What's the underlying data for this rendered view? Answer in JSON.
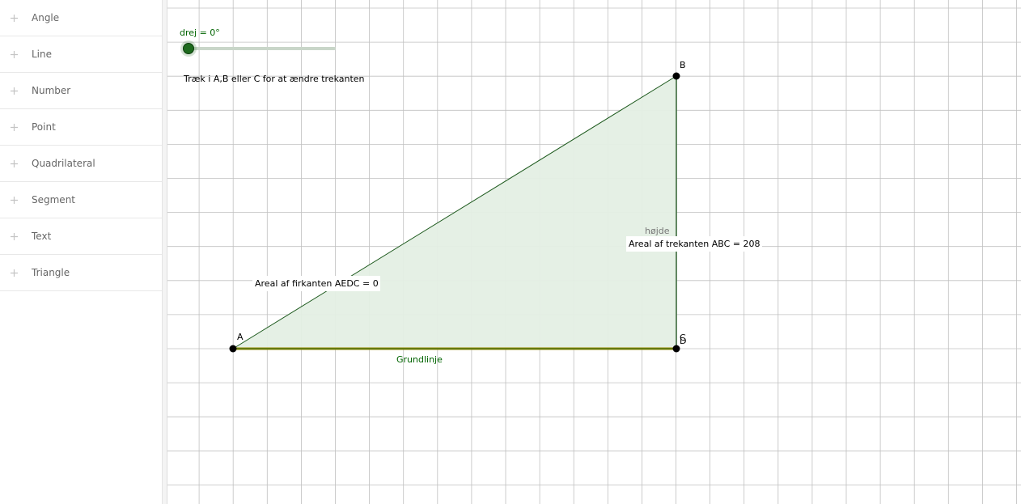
{
  "sidebar": {
    "items": [
      {
        "label": "Angle"
      },
      {
        "label": "Line"
      },
      {
        "label": "Number"
      },
      {
        "label": "Point"
      },
      {
        "label": "Quadrilateral"
      },
      {
        "label": "Segment"
      },
      {
        "label": "Text"
      },
      {
        "label": "Triangle"
      }
    ]
  },
  "graphics": {
    "slider": {
      "label": "drej = 0°",
      "value_degrees": 0
    },
    "instruction": "Træk i A,B eller C for at ændre trekanten",
    "points": {
      "A": "A",
      "B": "B",
      "C": "C",
      "D": "D"
    },
    "labels": {
      "baseline": "Grundlinje",
      "height": "højde",
      "area_triangle": "Areal af trekanten ABC = 208",
      "area_quadrilateral": "Areal af firkanten AEDC = 0"
    },
    "colors": {
      "grid": "#c0c0c0",
      "triangle_fill": "#e4efe4",
      "triangle_stroke": "#1e5a1e",
      "baseline": "#9a8a00",
      "accent": "#006400",
      "point": "#000000"
    }
  }
}
